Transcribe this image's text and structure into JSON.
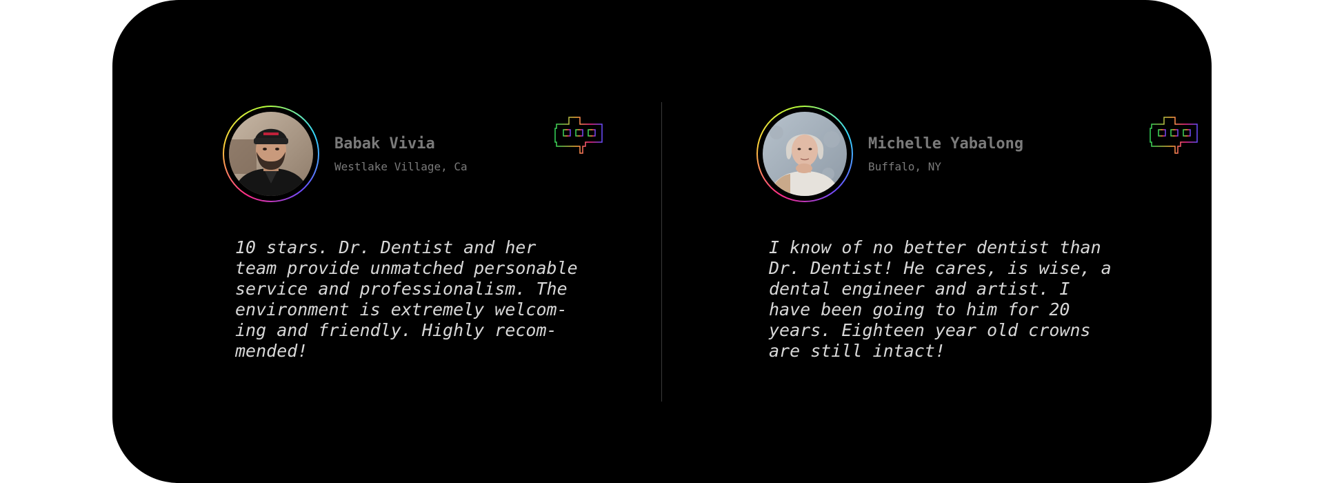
{
  "testimonials": [
    {
      "name": "Babak Vivia",
      "location": "Westlake Village, Ca",
      "quote": "10 stars. Dr. Dentist and her\nteam provide unmatched personable\nservice and professionalism. The\nenvironment is extremely welcom-\ning and friendly. Highly recom-\nmended!",
      "avatar": "man-with-beanie-photo",
      "badge_icon": "robot-icon"
    },
    {
      "name": "Michelle Yabalong",
      "location": "Buffalo, NY",
      "quote": "I know of no better dentist than\nDr. Dentist! He cares, is wise, a\ndental engineer and artist. I\nhave been going to him for 20\nyears. Eighteen year old crowns\nare still intact!",
      "avatar": "woman-portrait-photo",
      "badge_icon": "robot-icon"
    }
  ],
  "colors": {
    "panel_background": "#000000",
    "page_background": "#ffffff",
    "name_text": "#7a7a7a",
    "quote_text": "#d8d8d8",
    "divider": "#3a3a3a"
  }
}
